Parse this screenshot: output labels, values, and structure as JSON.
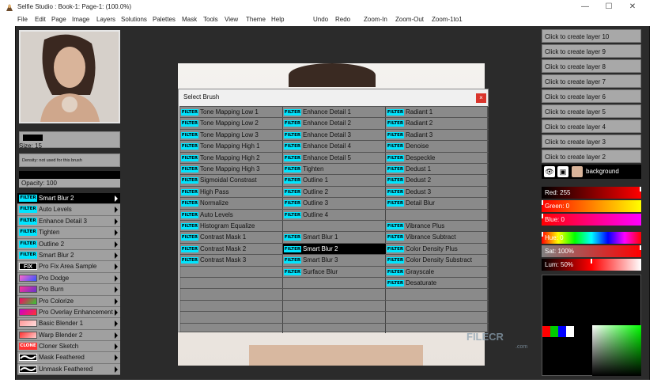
{
  "window": {
    "title": "Selfie Studio : Book-1: Page-1: (100.0%)"
  },
  "menu": [
    "File",
    "Edit",
    "Page",
    "Image",
    "Layers",
    "Solutions",
    "Palettes",
    "Mask",
    "Tools",
    "View",
    "Theme",
    "Help",
    "Undo",
    "Redo",
    "Zoom-In",
    "Zoom-Out",
    "Zoom-1to1"
  ],
  "left_panel": {
    "size_label": "Size: 15",
    "density_label": "Density: not used for this brush",
    "opacity_label": "Opacity: 100",
    "tools": [
      {
        "badge": "FILTER",
        "label": "Smart Blur 2",
        "selected": true
      },
      {
        "badge": "FILTER",
        "label": "Auto Levels"
      },
      {
        "badge": "FILTER",
        "label": "Enhance Detail 3"
      },
      {
        "badge": "FILTER",
        "label": "Tighten"
      },
      {
        "badge": "FILTER",
        "label": "Outline 2"
      },
      {
        "badge": "FILTER",
        "label": "Smart Blur 2"
      },
      {
        "badge": "FIX",
        "label": "Pro Fix Area Sample"
      },
      {
        "badge": "",
        "label": "Pro Dodge",
        "icon": "dodge-icon"
      },
      {
        "badge": "",
        "label": "Pro Burn",
        "icon": "burn-icon"
      },
      {
        "badge": "",
        "label": "Pro Colorize",
        "icon": "colorize-icon"
      },
      {
        "badge": "",
        "label": "Pro Overlay Enhancement",
        "icon": "overlay-icon"
      },
      {
        "badge": "",
        "label": "Basic Blender 1",
        "icon": "blender-icon"
      },
      {
        "badge": "",
        "label": "Warp Blender 2",
        "icon": "warp-icon"
      },
      {
        "badge": "CLONE",
        "label": "Cloner Sketch"
      },
      {
        "badge": "",
        "label": "Mask Feathered",
        "icon": "wave-icon"
      },
      {
        "badge": "",
        "label": "Unmask Feathered",
        "icon": "wave-icon"
      }
    ]
  },
  "dialog": {
    "title": "Select Brush",
    "close": "×",
    "badge": "FILTER",
    "columns": [
      [
        "Tone Mapping Low 1",
        "Tone Mapping Low 2",
        "Tone Mapping Low 3",
        "Tone Mapping High 1",
        "Tone Mapping High 2",
        "Tone Mapping High 3",
        "Sigmoidal Constrast",
        "High Pass",
        "Normalize",
        "Auto Levels",
        "Histogram Equalize",
        "Contrast Mask 1",
        "Contrast Mask 2",
        "Contrast Mask 3",
        "",
        "",
        "",
        "",
        ""
      ],
      [
        "Enhance Detail 1",
        "Enhance Detail 2",
        "Enhance Detail 3",
        "Enhance Detail 4",
        "Enhance Detail 5",
        "Tighten",
        "Outline 1",
        "Outline 2",
        "Outline 3",
        "Outline 4",
        "",
        "Smart Blur 1",
        "Smart Blur 2",
        "Smart Blur 3",
        "Surface Blur",
        "",
        "",
        "",
        ""
      ],
      [
        "Radiant 1",
        "Radiant 2",
        "Radiant 3",
        "Denoise",
        "Despeckle",
        "Dedust 1",
        "Dedust 2",
        "Dedust 3",
        "Detail Blur",
        "",
        "Vibrance Plus",
        "Vibrance Subtract",
        "Color Density Plus",
        "Color Density Substract",
        "Grayscale",
        "Desaturate",
        "",
        "",
        ""
      ]
    ],
    "selected": [
      1,
      12
    ]
  },
  "right_panel": {
    "layers": [
      "Click to create layer 10",
      "Click to create layer 9",
      "Click to create layer 8",
      "Click to create layer 7",
      "Click to create layer 6",
      "Click to create layer 5",
      "Click to create layer 4",
      "Click to create layer 3",
      "Click to create layer 2"
    ],
    "active_layer": "background",
    "sliders": [
      {
        "label": "Red: 255",
        "value": 1.0
      },
      {
        "label": "Green: 0",
        "value": 0.0
      },
      {
        "label": "Blue: 0",
        "value": 0.0
      },
      {
        "label": "Hue: 0",
        "value": 0.0
      },
      {
        "label": "Sat: 100%",
        "value": 1.0
      },
      {
        "label": "Lum: 50%",
        "value": 0.5
      }
    ]
  },
  "watermark": {
    "main": "FILECR",
    "sub": ".com"
  },
  "colors": {
    "filter_badge": "#00e5ff",
    "close": "#d9342b",
    "panel_gray": "#a0a0a0"
  }
}
